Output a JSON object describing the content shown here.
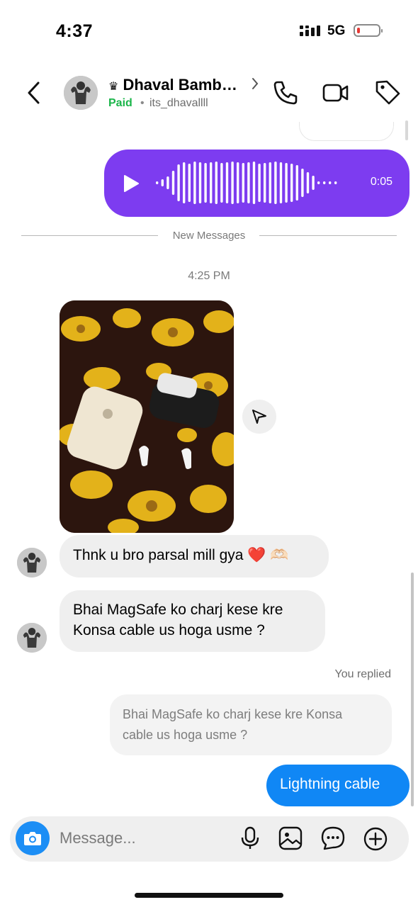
{
  "status": {
    "time": "4:37",
    "network": "5G",
    "battery_level": 0.15
  },
  "header": {
    "crown": "♛",
    "name": "Dhaval Bamb…",
    "paid": "Paid",
    "dot": "•",
    "username": "its_dhavallll"
  },
  "voice": {
    "duration": "0:05"
  },
  "separator": {
    "new_messages": "New Messages"
  },
  "timestamp": "4:25 PM",
  "messages": {
    "m1": "Thnk u bro parsal mill gya ❤️ 🫶🏻",
    "m2_line1": "Bhai MagSafe ko charj kese kre",
    "m2_line2": "Konsa cable us hoga usme ?",
    "replied_label": "You replied",
    "quote_line1": "Bhai MagSafe ko charj kese kre Konsa",
    "quote_line2": "cable us hoga usme ?",
    "reply": "Lightning cable"
  },
  "composer": {
    "placeholder": "Message..."
  },
  "colors": {
    "voice": "#7d3cf0",
    "outgoing": "#1087f5",
    "paid": "#1bb54a",
    "camera": "#1c8ef5"
  }
}
